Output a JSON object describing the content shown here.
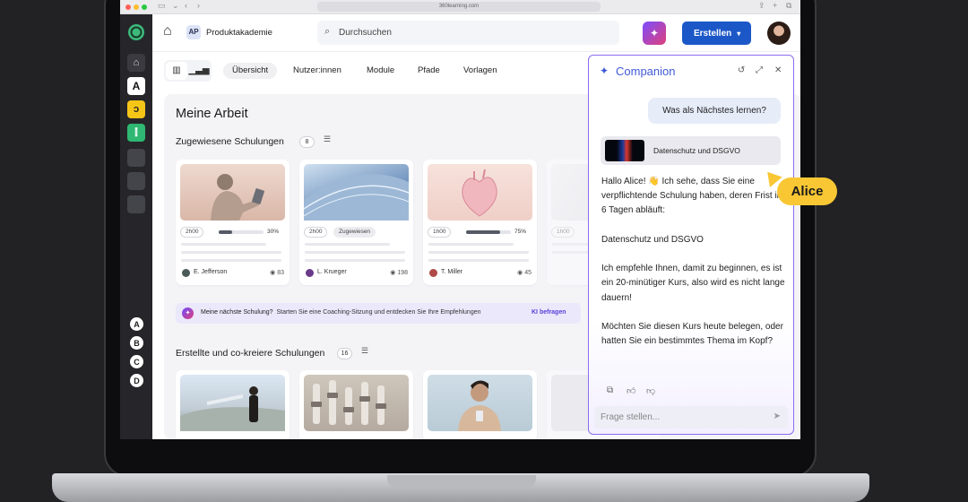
{
  "browser": {
    "url": "360learning.com"
  },
  "sidebar": {
    "letters": [
      "A",
      "B",
      "C",
      "D"
    ],
    "a_tile": "A"
  },
  "topbar": {
    "workspace_badge": "AP",
    "workspace_name": "Produktakademie",
    "search_placeholder": "Durchsuchen",
    "create_label": "Erstellen"
  },
  "tabs": [
    "Übersicht",
    "Nutzer:innen",
    "Module",
    "Pfade",
    "Vorlagen"
  ],
  "main": {
    "title": "Meine Arbeit",
    "assigned": {
      "title": "Zugewiesene Schulungen",
      "count": "8",
      "cards": [
        {
          "duration": "2h00",
          "progress": 0.3,
          "progress_label": "30%",
          "tag": "",
          "author": "E. Jefferson",
          "views": "83"
        },
        {
          "duration": "2h00",
          "progress": null,
          "progress_label": "",
          "tag": "Zugewiesen",
          "author": "L. Krueger",
          "views": "198"
        },
        {
          "duration": "1h00",
          "progress": 0.75,
          "progress_label": "75%",
          "tag": "",
          "author": "T. Miller",
          "views": "45"
        },
        {
          "duration": "1h00",
          "progress": null,
          "progress_label": "",
          "tag": "",
          "author": "",
          "views": ""
        }
      ]
    },
    "banner": {
      "question": "Meine nächste Schulung?",
      "text": "Starten Sie eine Coaching-Sitzung und entdecken Sie Ihre Empfehlungen",
      "link": "KI befragen"
    },
    "created": {
      "title": "Erstellte und co-kreiere Schulungen",
      "count": "16"
    }
  },
  "companion": {
    "title": "Companion",
    "user_message": "Was als Nächstes lernen?",
    "course_name": "Datenschutz und DSGVO",
    "reply": [
      "Hallo Alice! 👋 Ich sehe, dass Sie eine verpflichtende Schulung haben, deren Frist in 6 Tagen abläuft:",
      "Datenschutz und DSGVO",
      "Ich empfehle Ihnen, damit zu beginnen, es ist ein 20-minütiger Kurs, also wird es nicht lange dauern!",
      "Möchten Sie diesen Kurs heute belegen, oder hatten Sie ein bestimmtes Thema im Kopf?"
    ],
    "input_placeholder": "Frage stellen..."
  },
  "pointer_label": "Alice",
  "colors": {
    "accent": "#1c57c8",
    "companion_border": "#8b6cf0",
    "pointer": "#f8c733"
  }
}
